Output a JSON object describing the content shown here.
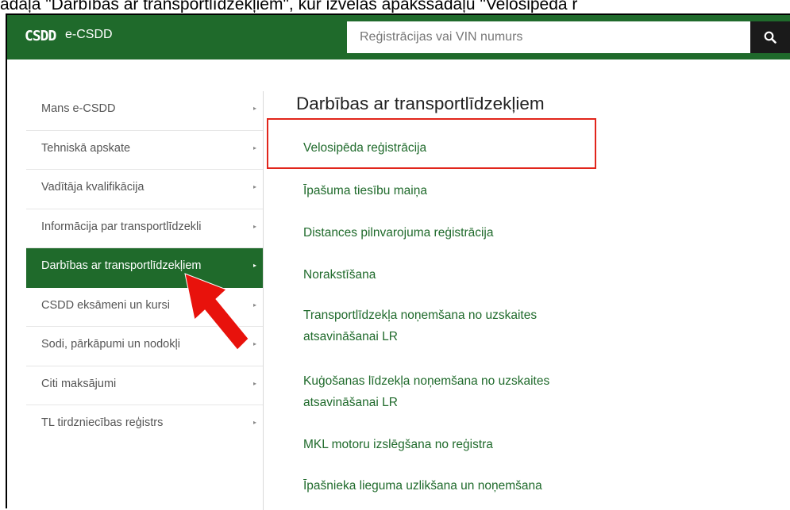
{
  "caption": "adaļā \"Darbības ar transportlīdzekļiem\", kur izvēlas apakšsadaļu \"Velosipēda r",
  "header": {
    "logo_text": "CSDD",
    "brand": "e-CSDD",
    "search_placeholder": "Reģistrācijas vai VIN numurs",
    "search_icon": "search-icon"
  },
  "sidebar": {
    "items": [
      {
        "label": "Mans e-CSDD",
        "arrow": "▸"
      },
      {
        "label": "Tehniskā apskate",
        "arrow": "▸"
      },
      {
        "label": "Vadītāja kvalifikācija",
        "arrow": "▸"
      },
      {
        "label": "Informācija par transportlīdzekli",
        "arrow": "▸"
      },
      {
        "label": "Darbības ar transportlīdzekļiem",
        "arrow": "▸",
        "active": true
      },
      {
        "label": "CSDD eksāmeni un kursi",
        "arrow": "▸"
      },
      {
        "label": "Sodi, pārkāpumi un nodokļi",
        "arrow": "▸"
      },
      {
        "label": "Citi maksājumi",
        "arrow": "▸"
      },
      {
        "label": "TL tirdzniecības reģistrs",
        "arrow": "▸"
      }
    ]
  },
  "main": {
    "heading": "Darbības ar transportlīdzekļiem",
    "links": [
      {
        "line1": "Velosipēda reģistrācija",
        "line2": ""
      },
      {
        "line1": "Īpašuma tiesību maiņa",
        "line2": ""
      },
      {
        "line1": "Distances pilnvarojuma reģistrācija",
        "line2": ""
      },
      {
        "line1": "Norakstīšana",
        "line2": ""
      },
      {
        "line1": "Transportlīdzekļa noņemšana no uzskaites",
        "line2": "atsavināšanai LR"
      },
      {
        "line1": "Kuģošanas līdzekļa noņemšana no uzskaites",
        "line2": "atsavināšanai LR"
      },
      {
        "line1": "MKL motoru izslēgšana no reģistra",
        "line2": ""
      },
      {
        "line1": "Īpašnieka lieguma uzlikšana un noņemšana",
        "line2": ""
      }
    ]
  },
  "annotation": {
    "highlight_color": "#e1251b",
    "arrow_color": "#e8120c"
  },
  "colors": {
    "brand_green": "#1f6a2b",
    "search_button": "#1a1a1a"
  }
}
